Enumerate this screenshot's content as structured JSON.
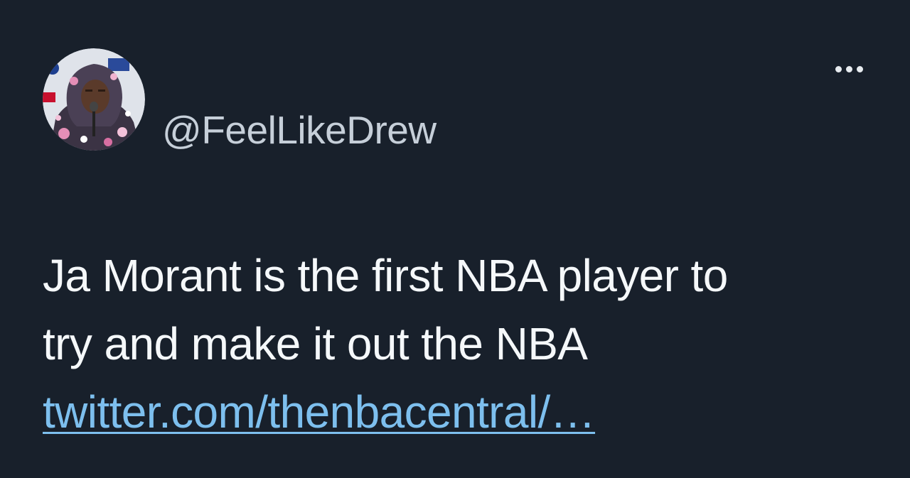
{
  "tweet": {
    "handle": "@FeelLikeDrew",
    "text_line_1": "Ja Morant is the first NBA player to",
    "text_line_2": "try and make it out the NBA",
    "link_text": "twitter.com/thenbacentral/…"
  },
  "icons": {
    "more": "more-horizontal-icon",
    "avatar": "profile-photo"
  },
  "colors": {
    "background": "#18202b",
    "handle": "#c6cfd9",
    "text": "#f5f8fa",
    "link": "#7dbfee"
  }
}
